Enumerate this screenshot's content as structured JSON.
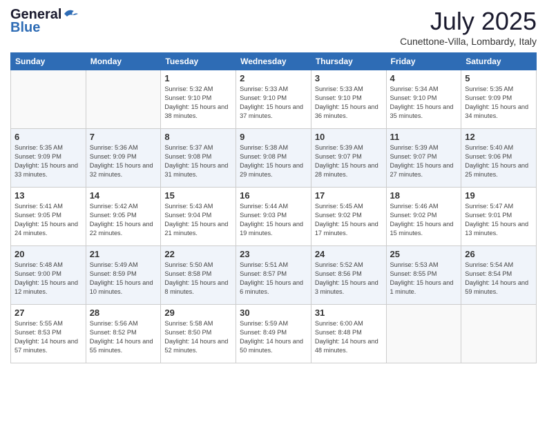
{
  "header": {
    "logo_general": "General",
    "logo_blue": "Blue",
    "month_title": "July 2025",
    "location": "Cunettone-Villa, Lombardy, Italy"
  },
  "weekdays": [
    "Sunday",
    "Monday",
    "Tuesday",
    "Wednesday",
    "Thursday",
    "Friday",
    "Saturday"
  ],
  "weeks": [
    [
      {
        "day": "",
        "empty": true
      },
      {
        "day": "",
        "empty": true
      },
      {
        "day": "1",
        "sunrise": "5:32 AM",
        "sunset": "9:10 PM",
        "daylight": "15 hours and 38 minutes."
      },
      {
        "day": "2",
        "sunrise": "5:33 AM",
        "sunset": "9:10 PM",
        "daylight": "15 hours and 37 minutes."
      },
      {
        "day": "3",
        "sunrise": "5:33 AM",
        "sunset": "9:10 PM",
        "daylight": "15 hours and 36 minutes."
      },
      {
        "day": "4",
        "sunrise": "5:34 AM",
        "sunset": "9:10 PM",
        "daylight": "15 hours and 35 minutes."
      },
      {
        "day": "5",
        "sunrise": "5:35 AM",
        "sunset": "9:09 PM",
        "daylight": "15 hours and 34 minutes."
      }
    ],
    [
      {
        "day": "6",
        "sunrise": "5:35 AM",
        "sunset": "9:09 PM",
        "daylight": "15 hours and 33 minutes."
      },
      {
        "day": "7",
        "sunrise": "5:36 AM",
        "sunset": "9:09 PM",
        "daylight": "15 hours and 32 minutes."
      },
      {
        "day": "8",
        "sunrise": "5:37 AM",
        "sunset": "9:08 PM",
        "daylight": "15 hours and 31 minutes."
      },
      {
        "day": "9",
        "sunrise": "5:38 AM",
        "sunset": "9:08 PM",
        "daylight": "15 hours and 29 minutes."
      },
      {
        "day": "10",
        "sunrise": "5:39 AM",
        "sunset": "9:07 PM",
        "daylight": "15 hours and 28 minutes."
      },
      {
        "day": "11",
        "sunrise": "5:39 AM",
        "sunset": "9:07 PM",
        "daylight": "15 hours and 27 minutes."
      },
      {
        "day": "12",
        "sunrise": "5:40 AM",
        "sunset": "9:06 PM",
        "daylight": "15 hours and 25 minutes."
      }
    ],
    [
      {
        "day": "13",
        "sunrise": "5:41 AM",
        "sunset": "9:05 PM",
        "daylight": "15 hours and 24 minutes."
      },
      {
        "day": "14",
        "sunrise": "5:42 AM",
        "sunset": "9:05 PM",
        "daylight": "15 hours and 22 minutes."
      },
      {
        "day": "15",
        "sunrise": "5:43 AM",
        "sunset": "9:04 PM",
        "daylight": "15 hours and 21 minutes."
      },
      {
        "day": "16",
        "sunrise": "5:44 AM",
        "sunset": "9:03 PM",
        "daylight": "15 hours and 19 minutes."
      },
      {
        "day": "17",
        "sunrise": "5:45 AM",
        "sunset": "9:02 PM",
        "daylight": "15 hours and 17 minutes."
      },
      {
        "day": "18",
        "sunrise": "5:46 AM",
        "sunset": "9:02 PM",
        "daylight": "15 hours and 15 minutes."
      },
      {
        "day": "19",
        "sunrise": "5:47 AM",
        "sunset": "9:01 PM",
        "daylight": "15 hours and 13 minutes."
      }
    ],
    [
      {
        "day": "20",
        "sunrise": "5:48 AM",
        "sunset": "9:00 PM",
        "daylight": "15 hours and 12 minutes."
      },
      {
        "day": "21",
        "sunrise": "5:49 AM",
        "sunset": "8:59 PM",
        "daylight": "15 hours and 10 minutes."
      },
      {
        "day": "22",
        "sunrise": "5:50 AM",
        "sunset": "8:58 PM",
        "daylight": "15 hours and 8 minutes."
      },
      {
        "day": "23",
        "sunrise": "5:51 AM",
        "sunset": "8:57 PM",
        "daylight": "15 hours and 6 minutes."
      },
      {
        "day": "24",
        "sunrise": "5:52 AM",
        "sunset": "8:56 PM",
        "daylight": "15 hours and 3 minutes."
      },
      {
        "day": "25",
        "sunrise": "5:53 AM",
        "sunset": "8:55 PM",
        "daylight": "15 hours and 1 minute."
      },
      {
        "day": "26",
        "sunrise": "5:54 AM",
        "sunset": "8:54 PM",
        "daylight": "14 hours and 59 minutes."
      }
    ],
    [
      {
        "day": "27",
        "sunrise": "5:55 AM",
        "sunset": "8:53 PM",
        "daylight": "14 hours and 57 minutes."
      },
      {
        "day": "28",
        "sunrise": "5:56 AM",
        "sunset": "8:52 PM",
        "daylight": "14 hours and 55 minutes."
      },
      {
        "day": "29",
        "sunrise": "5:58 AM",
        "sunset": "8:50 PM",
        "daylight": "14 hours and 52 minutes."
      },
      {
        "day": "30",
        "sunrise": "5:59 AM",
        "sunset": "8:49 PM",
        "daylight": "14 hours and 50 minutes."
      },
      {
        "day": "31",
        "sunrise": "6:00 AM",
        "sunset": "8:48 PM",
        "daylight": "14 hours and 48 minutes."
      },
      {
        "day": "",
        "empty": true
      },
      {
        "day": "",
        "empty": true
      }
    ]
  ],
  "labels": {
    "sunrise": "Sunrise:",
    "sunset": "Sunset:",
    "daylight": "Daylight:"
  }
}
